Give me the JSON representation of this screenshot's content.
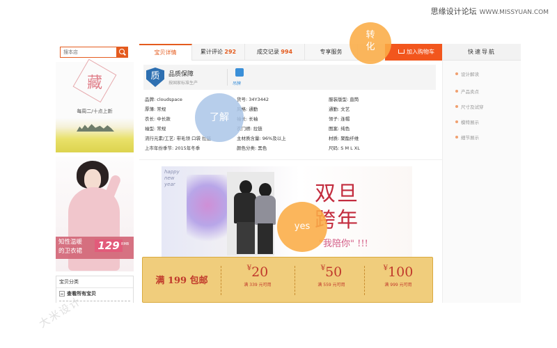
{
  "watermark": {
    "top_brand": "思缘设计论坛",
    "top_site": "WWW.MISSYUAN.COM",
    "corner": "大米设计"
  },
  "search": {
    "placeholder": "搜本店"
  },
  "shop_banner": {
    "logo_char": "藏",
    "schedule": "每周二/十点上新"
  },
  "side_promo": {
    "text_line1": "知性温暖",
    "text_line2": "的卫衣裙",
    "price": "129",
    "price_unit": "RMB"
  },
  "category": {
    "title": "宝贝分类",
    "item": "查看所有宝贝"
  },
  "tabs": [
    {
      "label": "宝贝详情",
      "count": ""
    },
    {
      "label": "累计评论",
      "count": "292"
    },
    {
      "label": "成交记录",
      "count": "994"
    },
    {
      "label": "专享服务",
      "count": ""
    }
  ],
  "cart": {
    "label": "加入购物车"
  },
  "quality": {
    "icon_char": "质",
    "title": "品质保障",
    "subtitle": "按国家标准生产",
    "tag": "吊牌"
  },
  "attributes": [
    "品牌: cloudspace",
    "货号: 34Y3442",
    "服装版型: 直筒",
    "厚薄: 常规",
    "风格: 通勤",
    "通勤: 文艺",
    "衣长: 中长款",
    "袖长: 长袖",
    "领子: 连帽",
    "袖型: 常规",
    "衣门襟: 拉链",
    "图案: 纯色",
    "流行元素/工艺: 带毛领 口袋 拉链",
    "主材质含量: 96%及以上",
    "材质: 聚酯纤维",
    "上市年份季节: 2015年冬季",
    "颜色分类: 黑色",
    "尺码: S M L XL"
  ],
  "poster": {
    "hny_line1": "happy",
    "hny_line2": "new",
    "hny_line3": "year",
    "title_line1": "双旦",
    "title_line2": "跨年",
    "subtitle": "\"我陪你\" !!!"
  },
  "coupons": {
    "main": "满 199 包邮",
    "currency": "¥",
    "items": [
      {
        "amount": "20",
        "condition": "满 339 元可用"
      },
      {
        "amount": "50",
        "condition": "满 559 元可用"
      },
      {
        "amount": "100",
        "condition": "满 999 元可用"
      }
    ]
  },
  "callouts": {
    "convert_line1": "转",
    "convert_line2": "化",
    "understand": "了解",
    "yes": "yes"
  },
  "right_nav": {
    "title": "快速导航",
    "items": [
      "设计解读",
      "产品卖点",
      "尺寸及试穿",
      "模特展示",
      "细节展示"
    ]
  },
  "colors": {
    "accent": "#f2561d",
    "coupon_bg": "#f0cd7c",
    "poster_red": "#c32c3e"
  }
}
